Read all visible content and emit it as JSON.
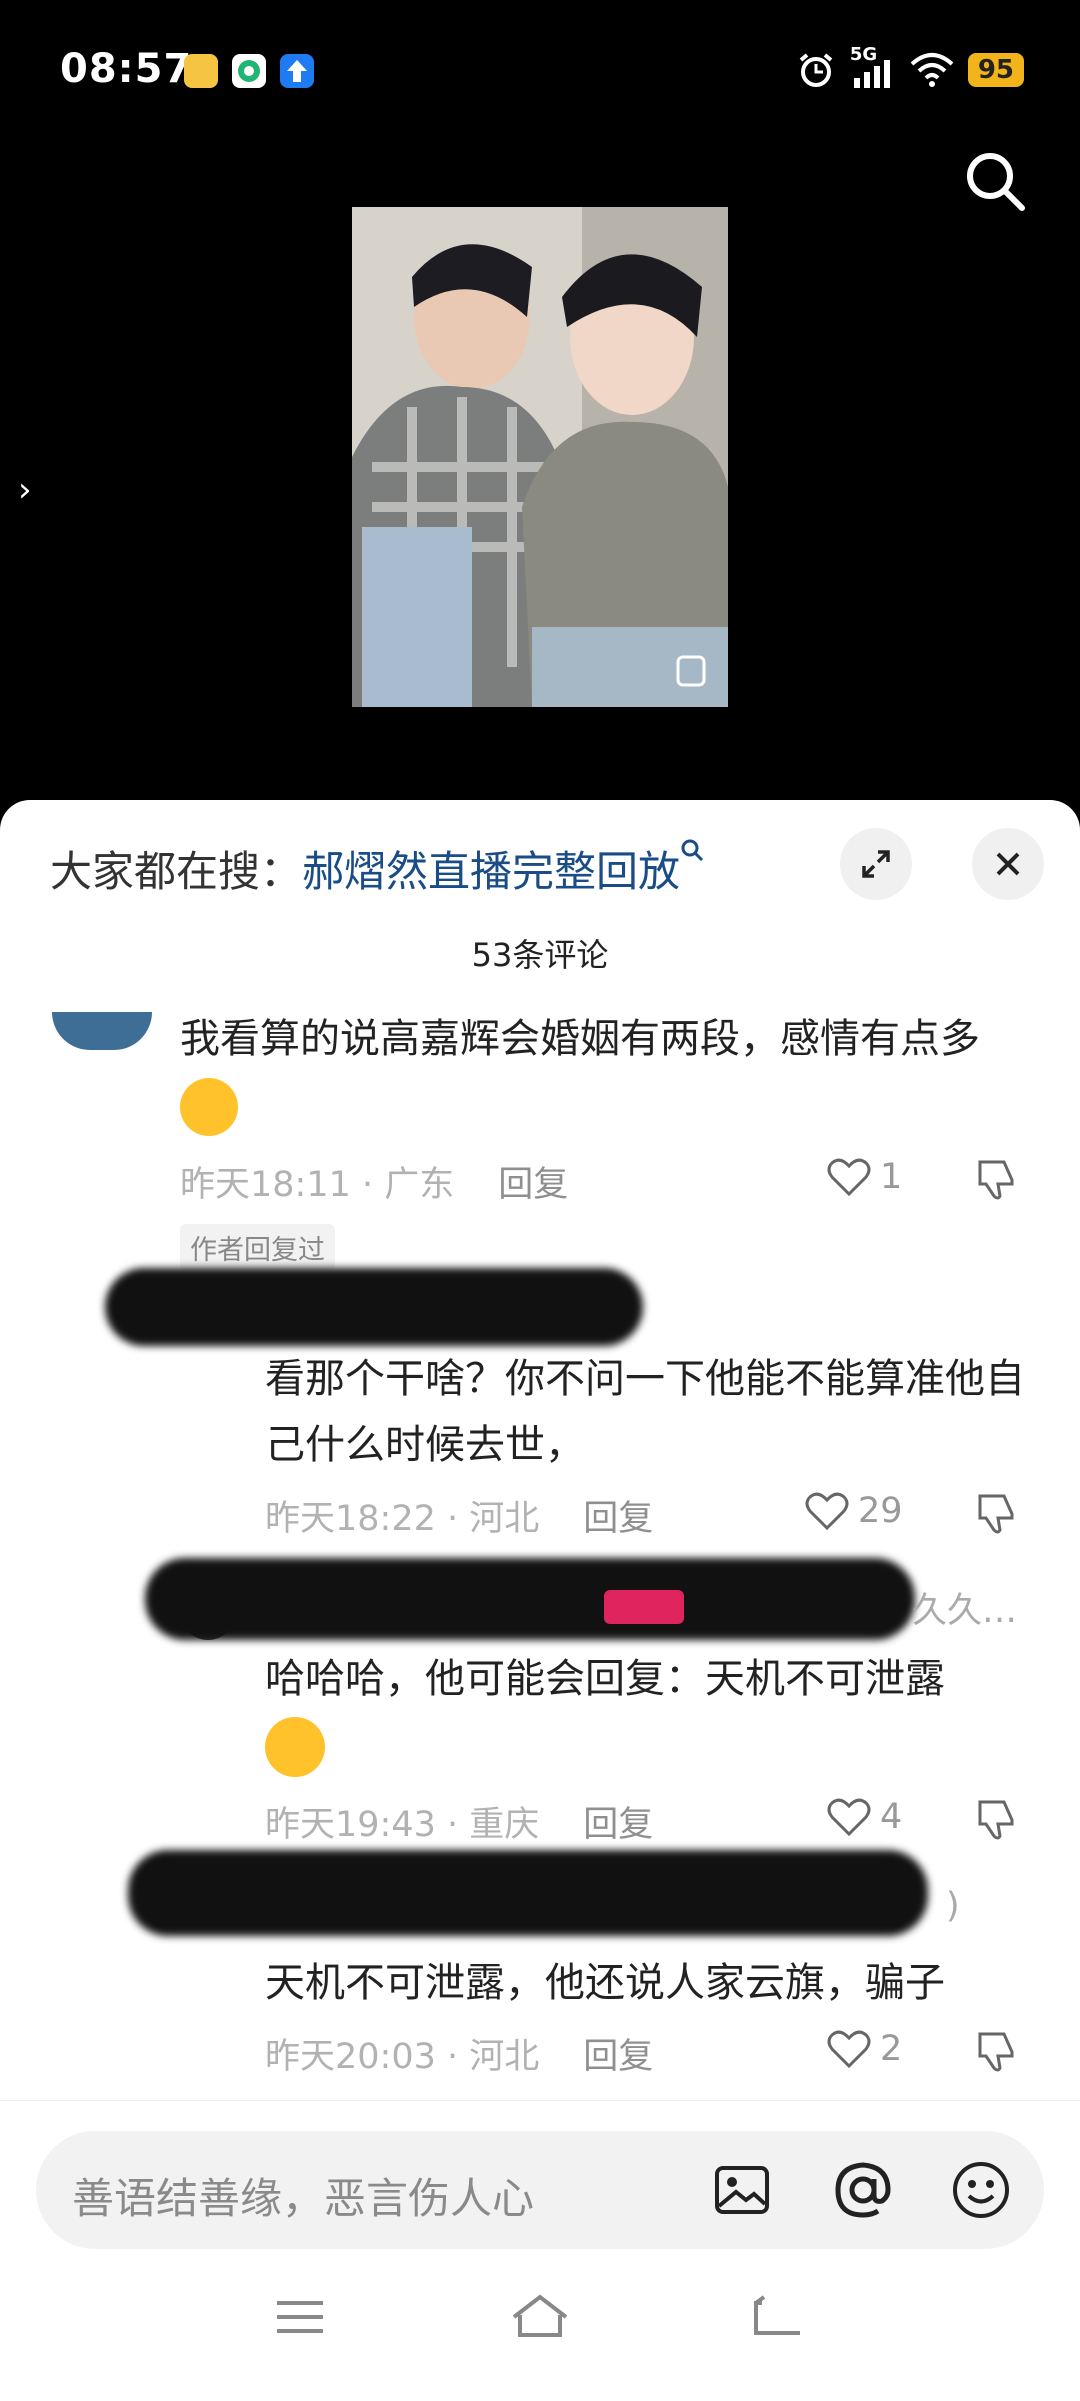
{
  "status_bar": {
    "time": "08:57",
    "battery": "95",
    "notification_icons": [
      "meituan-icon",
      "green-circle-app-icon",
      "upload-arrow-icon"
    ],
    "system_icons": [
      "alarm-icon",
      "5g-signal-icon",
      "wifi-icon"
    ],
    "network": "5G"
  },
  "comment_sheet": {
    "hot_search_label": "大家都在搜：",
    "hot_search_keyword": "郝熠然直播完整回放",
    "comment_count": "53条评论",
    "comments": [
      {
        "text": "我看算的说高嘉辉会婚姻有两段，感情有点多",
        "time": "昨天18:11",
        "location": "广东",
        "reply_label": "回复",
        "likes": "1",
        "tag": "作者回复过"
      },
      {
        "text": "看那个干啥？你不问一下他能不能算准他自己什么时候去世，",
        "time": "昨天18:22",
        "location": "河北",
        "reply_label": "回复",
        "likes": "29"
      },
      {
        "text": "哈哈哈，他可能会回复：天机不可泄露",
        "time": "昨天19:43",
        "location": "重庆",
        "reply_label": "回复",
        "likes": "4"
      },
      {
        "text": "天机不可泄露，他还说人家云旗，骗子",
        "time": "昨天20:03",
        "location": "河北",
        "reply_label": "回复",
        "likes": "2"
      }
    ],
    "partial_usernames": [
      "久久…",
      ")"
    ]
  },
  "input_bar": {
    "placeholder": "善语结善缘，恶言伤人心"
  },
  "colors": {
    "keyword": "#1a4d88",
    "battery": "#f3b41b"
  }
}
